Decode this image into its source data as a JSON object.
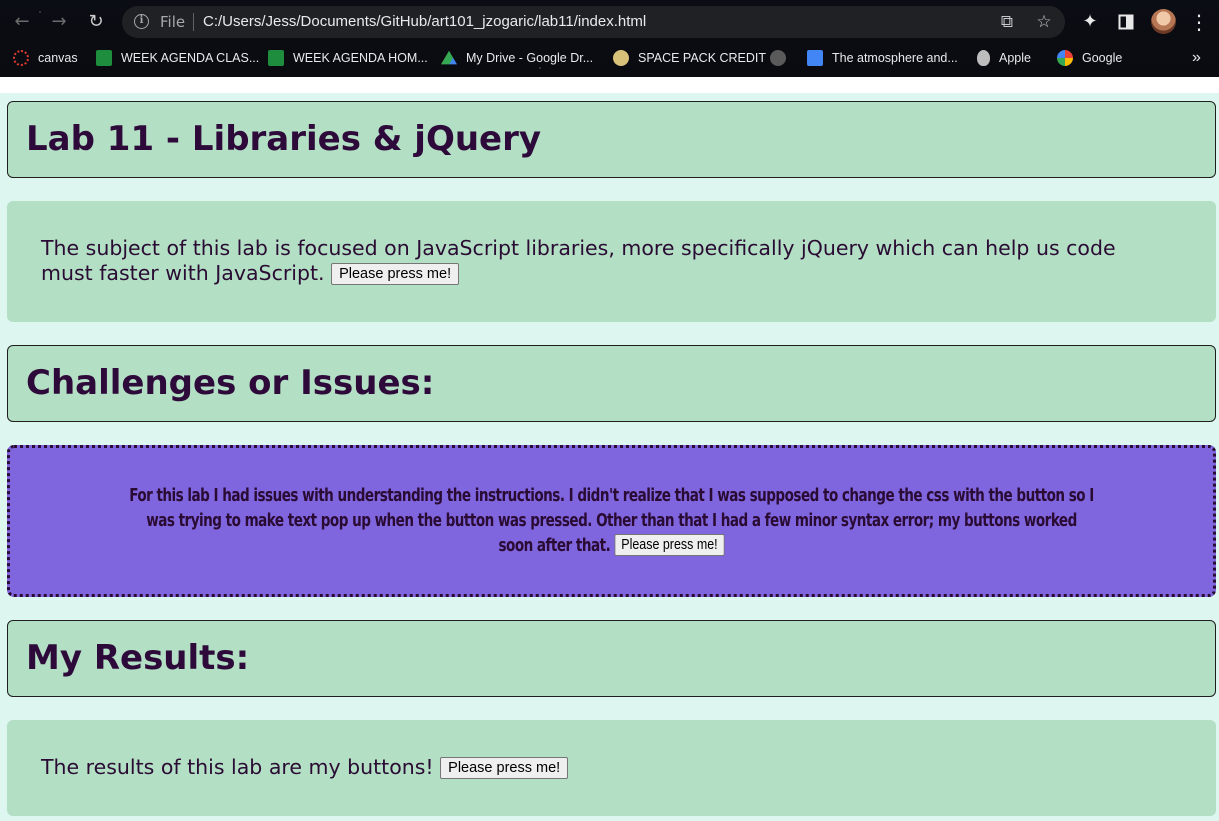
{
  "browser": {
    "file_label": "File",
    "url": "C:/Users/Jess/Documents/GitHub/art101_jzogaric/lab11/index.html",
    "bookmarks": [
      {
        "label": "canvas",
        "icon": "canvas-icon",
        "color": "#e03c31"
      },
      {
        "label": "WEEK AGENDA CLAS...",
        "icon": "sheets-icon",
        "color": "#1e8e3e"
      },
      {
        "label": "WEEK AGENDA HOM...",
        "icon": "sheets-icon",
        "color": "#1e8e3e"
      },
      {
        "label": "My Drive - Google Dr...",
        "icon": "drive-icon",
        "color": "#fbbc04"
      },
      {
        "label": "SPACE PACK CREDIT",
        "icon": "space-pack-icon",
        "color": "#d8c27a"
      },
      {
        "label": "",
        "icon": "globe-icon",
        "color": "#8a8a8a"
      },
      {
        "label": "The atmosphere and...",
        "icon": "docs-icon",
        "color": "#4285f4"
      },
      {
        "label": "Apple",
        "icon": "apple-icon",
        "color": "#cfcfcf"
      },
      {
        "label": "Google",
        "icon": "google-icon",
        "color": "#ffffff"
      }
    ],
    "more_bookmarks": "»"
  },
  "page": {
    "title": "Lab 11 - Libraries & jQuery",
    "intro_text": "The subject of this lab is focused on JavaScript libraries, more specifically jQuery which can help us code must faster with JavaScript.",
    "challenges_heading": "Challenges or Issues:",
    "challenges_text": "For this lab I had issues with understanding the instructions. I didn't realize that I was supposed to change the css with the button so I was trying to make text pop up when the button was pressed. Other than that I had a few minor syntax error; my buttons worked soon after that.",
    "results_heading": "My Results:",
    "results_text": "The results of this lab are my buttons!",
    "button_label": "Please press me!"
  },
  "colors": {
    "page_bg": "#ddf6ef",
    "box_bg": "#b3dfc4",
    "purple_box_bg": "#7f65de",
    "text": "#2a0b33"
  }
}
